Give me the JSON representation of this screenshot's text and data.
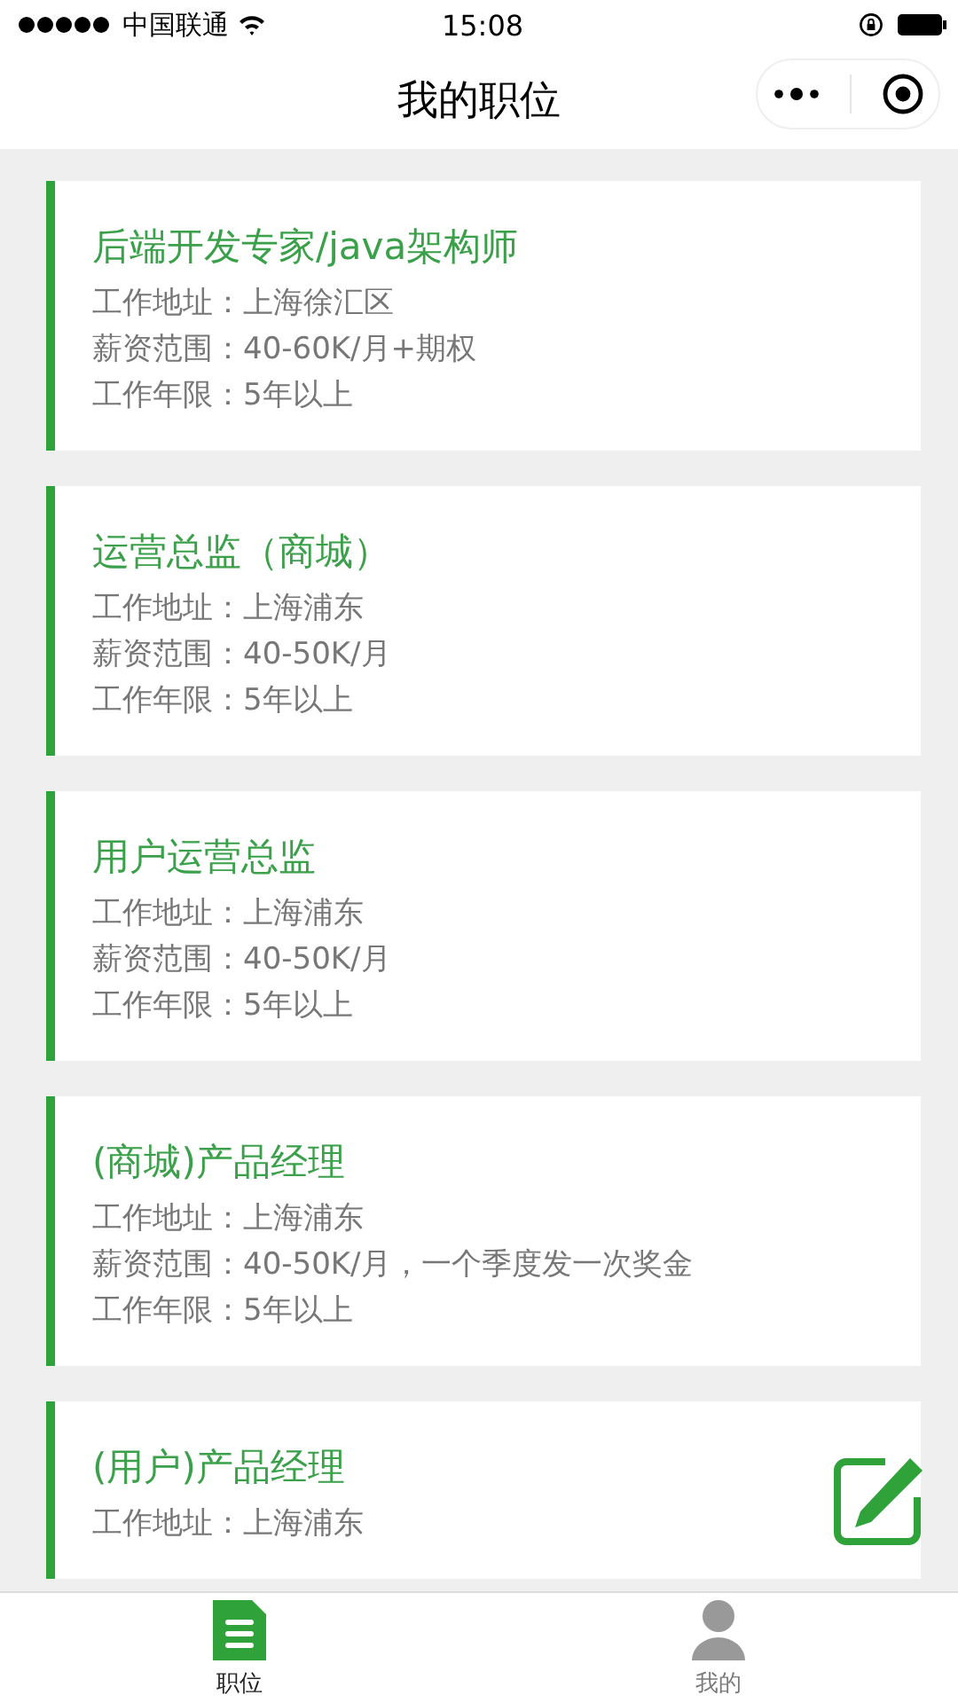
{
  "status_bar": {
    "carrier": "中国联通",
    "time": "15:08"
  },
  "nav_bar": {
    "title": "我的职位"
  },
  "jobs": [
    {
      "title": "后端开发专家/java架构师",
      "lines": [
        "工作地址：上海徐汇区",
        "薪资范围：40-60K/月+期权",
        "工作年限：5年以上"
      ]
    },
    {
      "title": "运营总监（商城）",
      "lines": [
        "工作地址：上海浦东",
        "薪资范围：40-50K/月",
        "工作年限：5年以上"
      ]
    },
    {
      "title": "用户运营总监",
      "lines": [
        "工作地址：上海浦东",
        "薪资范围：40-50K/月",
        "工作年限：5年以上"
      ]
    },
    {
      "title": "(商城)产品经理",
      "lines": [
        "工作地址：上海浦东",
        "薪资范围：40-50K/月，一个季度发一次奖金",
        "工作年限：5年以上"
      ]
    },
    {
      "title": "(用户)产品经理",
      "lines": [
        "工作地址：上海浦东"
      ]
    }
  ],
  "tab_bar": [
    {
      "label": "职位",
      "kind": "document",
      "selected": true
    },
    {
      "label": "我的",
      "kind": "person",
      "selected": false
    }
  ]
}
